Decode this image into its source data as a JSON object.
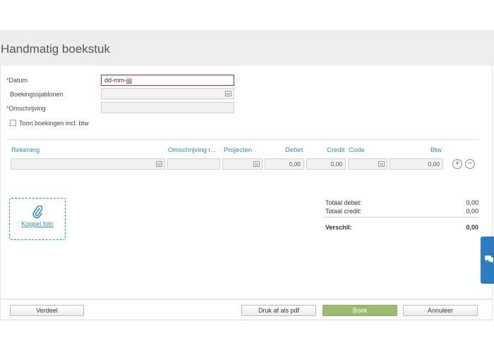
{
  "title": "Handmatig boekstuk",
  "form": {
    "datum_label": "Datum",
    "datum_value": "dd-mm-jjjj",
    "sjablonen_label": "Boekingssjablonen",
    "omschrijving_label": "Omschrijving",
    "btw_checkbox_label": "Toon boekingen incl. btw"
  },
  "table": {
    "headers": {
      "rekening": "Rekening",
      "omschrijving": "Omschrijving r...",
      "projecten": "Projecten",
      "debet": "Debet",
      "credit": "Credit",
      "code": "Code",
      "btw": "Btw"
    },
    "row": {
      "debet": "0,00",
      "credit": "0,00",
      "btw": "0,00"
    }
  },
  "attach": {
    "label": "Koppel foto"
  },
  "totals": {
    "debet_label": "Totaal debet:",
    "debet_value": "0,00",
    "credit_label": "Totaal credit:",
    "credit_value": "0,00",
    "verschil_label": "Verschil:",
    "verschil_value": "0,00"
  },
  "buttons": {
    "verdeel": "Verdeel",
    "print": "Druk af als pdf",
    "boek": "Boek",
    "annuleer": "Annuleer"
  },
  "colors": {
    "accent": "#3a87c8",
    "required": "#c0392b",
    "primary_button": "#9bbc6f",
    "side_tab": "#2b7cc1"
  },
  "icons": {
    "attach": "paperclip-icon",
    "side_tab": "chat-icon",
    "picker": "list-picker-icon"
  }
}
